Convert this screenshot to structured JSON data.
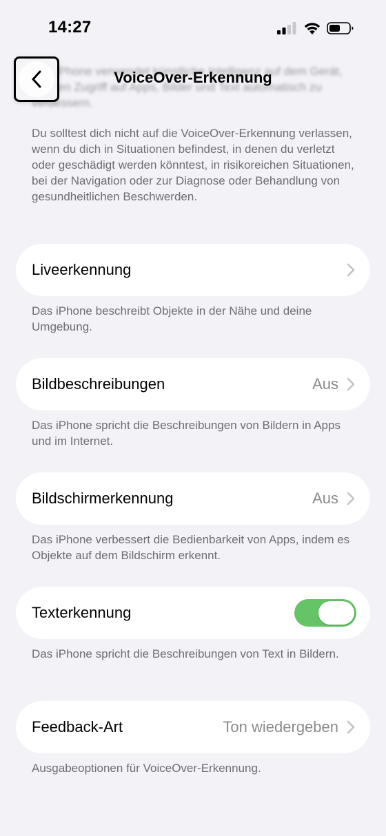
{
  "status_bar": {
    "time": "14:27",
    "signal_icon": "cellular-signal-icon",
    "wifi_icon": "wifi-icon",
    "battery_icon": "battery-icon"
  },
  "nav": {
    "title": "VoiceOver-Erkennung",
    "back_icon": "chevron-left-icon"
  },
  "intro": {
    "blurred_text": "Das iPhone verwendet künstliche Intelligenz auf dem Gerät, um den Zugriff auf Apps, Bilder und Text automatisch zu verbessern.",
    "text": "Du solltest dich nicht auf die VoiceOver-Erkennung verlassen, wenn du dich in Situationen befindest, in denen du verletzt oder geschädigt werden könntest, in risikoreichen Situationen, bei der Navigation oder zur Diagnose oder Behandlung von gesundheitlichen Beschwerden."
  },
  "rows": [
    {
      "label": "Liveerkennung",
      "value": "",
      "footer": "Das iPhone beschreibt Objekte in der Nähe und deine Umgebung."
    },
    {
      "label": "Bildbeschreibungen",
      "value": "Aus",
      "footer": "Das iPhone spricht die Beschreibungen von Bildern in Apps und im Internet."
    },
    {
      "label": "Bildschirmerkennung",
      "value": "Aus",
      "footer": "Das iPhone verbessert die Bedienbarkeit von Apps, indem es Objekte auf dem Bildschirm erkennt."
    },
    {
      "label": "Texterkennung",
      "toggle_on": true,
      "footer": "Das iPhone spricht die Beschreibungen von Text in Bildern."
    },
    {
      "label": "Feedback-Art",
      "value": "Ton wiedergeben",
      "footer": "Ausgabeoptionen für VoiceOver-Erkennung."
    }
  ],
  "colors": {
    "background": "#f2f2f7",
    "toggle_on": "#65c466",
    "secondary_text": "#6d6d72",
    "value_text": "#8a8a8e"
  }
}
